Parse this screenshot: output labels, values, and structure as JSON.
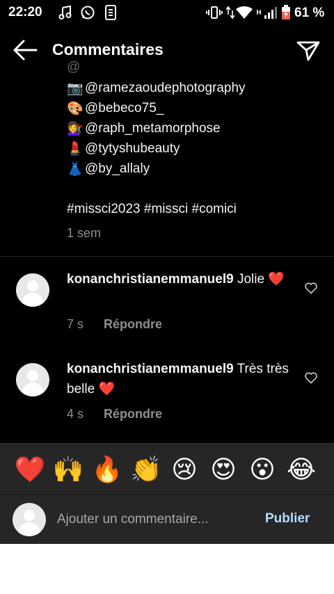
{
  "status_bar": {
    "time": "22:20",
    "battery_percent": "61 %",
    "network_label": "H",
    "icons": [
      "music-note-icon",
      "whatsapp-icon",
      "sim-card-icon",
      "vibrate-icon",
      "data-arrows-icon",
      "wifi-icon",
      "signal-icon",
      "battery-icon"
    ]
  },
  "header": {
    "title": "Commentaires",
    "back_icon": "arrow-left-icon",
    "send_icon": "paper-plane-icon"
  },
  "caption": {
    "mentions": [
      {
        "emoji": "📷",
        "handle": "@ramezaoudephotography"
      },
      {
        "emoji": "🎨",
        "handle": "@bebeco75_"
      },
      {
        "emoji": "💇‍♀️",
        "handle": "@raph_metamorphose"
      },
      {
        "emoji": "💄",
        "handle": "@tytyshubeauty"
      },
      {
        "emoji": "👗",
        "handle": "@by_allaly"
      }
    ],
    "hashtags": "#missci2023 #missci #comici",
    "time": "1 sem"
  },
  "comments": [
    {
      "username": "konanchristianemmanuel9",
      "text": "Jolie",
      "emoji": "❤️",
      "time": "7 s",
      "reply_label": "Répondre"
    },
    {
      "username": "konanchristianemmanuel9",
      "text": "Très très belle",
      "emoji": "❤️",
      "time": "4 s",
      "reply_label": "Répondre"
    }
  ],
  "quick_emojis": [
    "❤️",
    "🙌",
    "🔥",
    "👏",
    "😢",
    "😍",
    "😮",
    "😂"
  ],
  "input": {
    "placeholder": "Ajouter un commentaire...",
    "publish_label": "Publier"
  },
  "colors": {
    "background": "#000000",
    "panel": "#262626",
    "muted_text": "#8e8e8e",
    "publish_accent": "#b2dffc"
  }
}
